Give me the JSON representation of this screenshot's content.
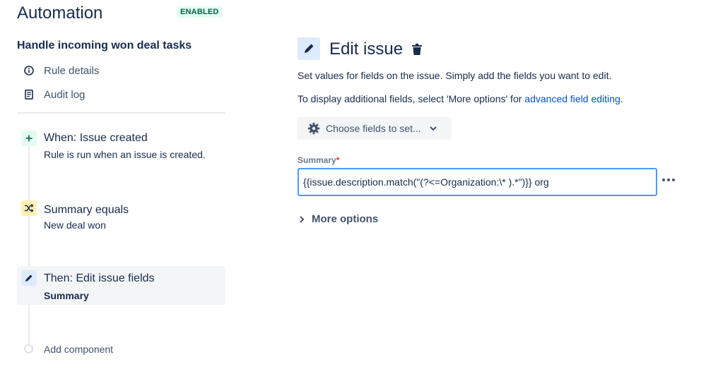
{
  "app": {
    "title": "Automation",
    "status": "ENABLED"
  },
  "sidebar": {
    "rule_name": "Handle incoming won deal tasks",
    "links": [
      {
        "label": "Rule details",
        "icon": "info-icon"
      },
      {
        "label": "Audit log",
        "icon": "document-icon"
      }
    ],
    "components": [
      {
        "title": "When: Issue created",
        "subtitle": "Rule is run when an issue is created.",
        "icon": "plus-icon",
        "color": "#e3fcef"
      },
      {
        "title": "Summary equals",
        "subtitle": "New deal won",
        "icon": "shuffle-icon",
        "color": "#fff0b3"
      },
      {
        "title": "Then: Edit issue fields",
        "subtitle": "Summary",
        "icon": "pencil-icon",
        "color": "#deebff"
      }
    ],
    "add_component": "Add component"
  },
  "main": {
    "title": "Edit issue",
    "description_1": "Set values for fields on the issue. Simply add the fields you want to edit.",
    "description_2_prefix": "To display additional fields, select 'More options' for ",
    "description_2_link": "advanced field editing",
    "description_2_suffix": ".",
    "choose_fields_label": "Choose fields to set...",
    "summary_label": "Summary",
    "summary_required": "*",
    "summary_value": "{{issue.description.match(\"(?<=Organization:\\* ).*\")}} org",
    "more_options_label": "More options"
  },
  "colors": {
    "accent_link": "#0052cc",
    "focus_border": "#4c9aff",
    "enabled_bg": "#e3fcef",
    "enabled_text": "#006644"
  }
}
